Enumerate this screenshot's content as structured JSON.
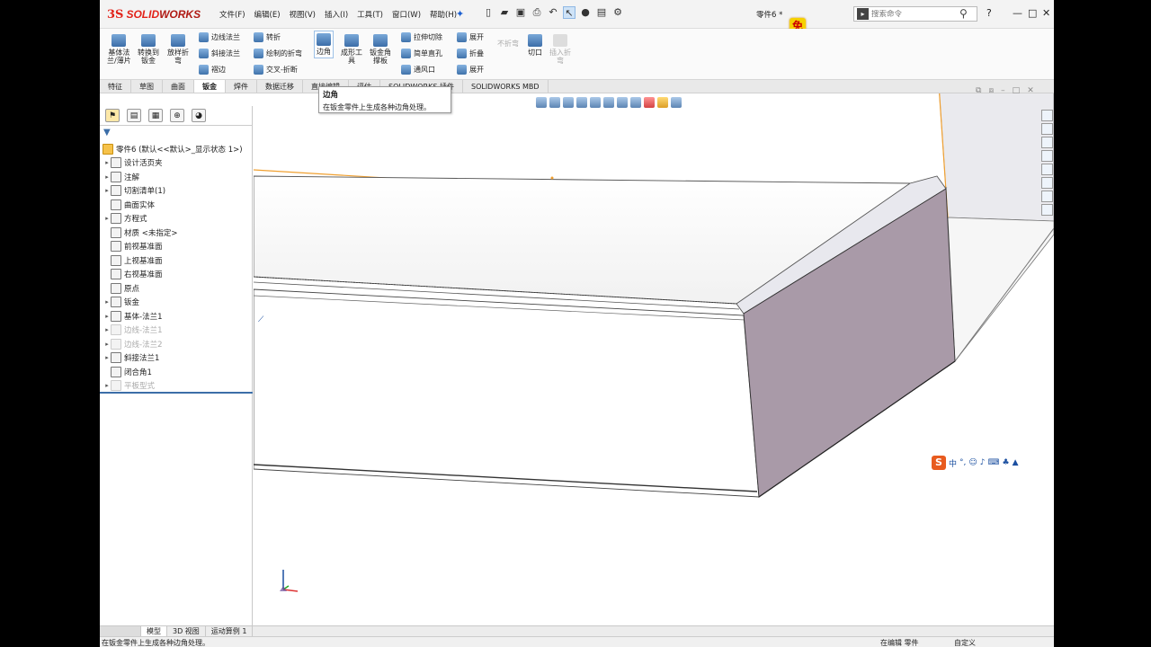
{
  "app": {
    "logo_ds": "3S",
    "logo_text_solid": "SOLID",
    "logo_text_works": "WORKS",
    "document_title": "零件6 *",
    "badge": "免",
    "colors": {
      "brand": "#e2231a",
      "accent": "#3c6ea8",
      "part_face": "#a99aa8",
      "edge_highlight": "#f0a030"
    }
  },
  "menu": [
    "文件(F)",
    "编辑(E)",
    "视图(V)",
    "插入(I)",
    "工具(T)",
    "窗口(W)",
    "帮助(H)"
  ],
  "search": {
    "placeholder": "搜索命令"
  },
  "window_controls": {
    "help": "?",
    "minimize": "—",
    "maximize": "□",
    "close": "✕"
  },
  "ribbon": {
    "base_flange": "基体法\n兰/薄片",
    "convert_to_sheet_metal": "转换到\n钣金",
    "lofted_bend": "放样折\n弯",
    "edge_flange": "边线法兰",
    "miter_flange": "斜接法兰",
    "hem": "褶边",
    "jog": "转折",
    "sketched_bend": "绘制的折弯",
    "cross_break": "交叉-折断",
    "corners": "边角",
    "forming_tool": "成形工\n具",
    "gusset": "钣金角\n撑板",
    "extruded_cut": "拉伸切除",
    "simple_hole": "简单直孔",
    "vent": "通风口",
    "unfold": "展开",
    "fold": "折叠",
    "flatten": "展开",
    "no_bends": "不折弯",
    "rip": "切口",
    "insert_bends": "插入折\n弯"
  },
  "tabs": [
    "特征",
    "草图",
    "曲面",
    "钣金",
    "焊件",
    "数据迁移",
    "直接编辑",
    "评估",
    "SOLIDWORKS 插件",
    "SOLIDWORKS MBD"
  ],
  "tooltip": {
    "title": "边角",
    "description": "在钣金零件上生成各种边角处理。"
  },
  "tree": {
    "root": "零件6 (默认<<默认>_显示状态 1>)",
    "items": [
      {
        "label": "设计活页夹",
        "dim": false,
        "arrow": true
      },
      {
        "label": "注解",
        "dim": false,
        "arrow": true
      },
      {
        "label": "切割清单(1)",
        "dim": false,
        "arrow": true
      },
      {
        "label": "曲面实体",
        "dim": false,
        "arrow": false
      },
      {
        "label": "方程式",
        "dim": false,
        "arrow": true
      },
      {
        "label": "材质 <未指定>",
        "dim": false,
        "arrow": false
      },
      {
        "label": "前视基准面",
        "dim": false,
        "arrow": false
      },
      {
        "label": "上视基准面",
        "dim": false,
        "arrow": false
      },
      {
        "label": "右视基准面",
        "dim": false,
        "arrow": false
      },
      {
        "label": "原点",
        "dim": false,
        "arrow": false
      },
      {
        "label": "钣金",
        "dim": false,
        "arrow": true
      },
      {
        "label": "基体-法兰1",
        "dim": false,
        "arrow": true
      },
      {
        "label": "边线-法兰1",
        "dim": true,
        "arrow": true
      },
      {
        "label": "边线-法兰2",
        "dim": true,
        "arrow": true
      },
      {
        "label": "斜接法兰1",
        "dim": false,
        "arrow": true
      },
      {
        "label": "闭合角1",
        "dim": false,
        "arrow": false
      },
      {
        "label": "平板型式",
        "dim": true,
        "arrow": true
      }
    ]
  },
  "ime": {
    "logo": "S",
    "mode": "中"
  },
  "bottom_tabs": [
    "模型",
    "3D 视图",
    "运动算例 1"
  ],
  "status": {
    "message": "在钣金零件上生成各种边角处理。",
    "editing": "在编辑 零件",
    "custom": "自定义"
  }
}
